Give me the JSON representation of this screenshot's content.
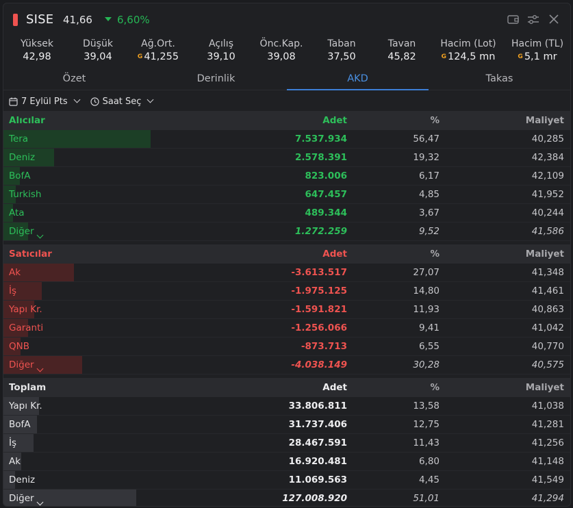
{
  "header": {
    "symbol": "SISE",
    "price": "41,66",
    "change": "6,60%",
    "colors": {
      "accent_red": "#ef5350",
      "up_green": "#26b655",
      "tab_blue": "#4a90e2"
    }
  },
  "stats": [
    {
      "label": "Yüksek",
      "value": "42,98"
    },
    {
      "label": "Düşük",
      "value": "39,04"
    },
    {
      "label": "Ağ.Ort.",
      "value": "41,255",
      "badge": "G"
    },
    {
      "label": "Açılış",
      "value": "39,10"
    },
    {
      "label": "Önc.Kap.",
      "value": "39,08"
    },
    {
      "label": "Taban",
      "value": "37,50"
    },
    {
      "label": "Tavan",
      "value": "45,82"
    },
    {
      "label": "Hacim (Lot)",
      "value": "124,5 mn",
      "badge": "G"
    },
    {
      "label": "Hacim (TL)",
      "value": "5,1 mr",
      "badge": "G"
    }
  ],
  "tabs": [
    {
      "label": "Özet"
    },
    {
      "label": "Derinlik"
    },
    {
      "label": "AKD",
      "active": true
    },
    {
      "label": "Takas"
    }
  ],
  "filters": {
    "date_label": "7 Eylül Pts",
    "time_label": "Saat Seç"
  },
  "buyers": {
    "title": "Alıcılar",
    "col_qty": "Adet",
    "col_pct": "%",
    "col_cost": "Maliyet",
    "rows": [
      {
        "name": "Tera",
        "qty": "7.537.934",
        "pct": "56,47",
        "cost": "40,285",
        "share": 56.47
      },
      {
        "name": "Deniz",
        "qty": "2.578.391",
        "pct": "19,32",
        "cost": "42,384",
        "share": 19.32
      },
      {
        "name": "BofA",
        "qty": "823.006",
        "pct": "6,17",
        "cost": "42,109",
        "share": 6.17
      },
      {
        "name": "Turkish",
        "qty": "647.457",
        "pct": "4,85",
        "cost": "41,952",
        "share": 4.85
      },
      {
        "name": "Ata",
        "qty": "489.344",
        "pct": "3,67",
        "cost": "40,244",
        "share": 3.67
      },
      {
        "name": "Diğer",
        "qty": "1.272.259",
        "pct": "9,52",
        "cost": "41,586",
        "share": 9.52,
        "other": true
      }
    ]
  },
  "sellers": {
    "title": "Satıcılar",
    "col_qty": "Adet",
    "col_pct": "%",
    "col_cost": "Maliyet",
    "rows": [
      {
        "name": "Ak",
        "qty": "-3.613.517",
        "pct": "27,07",
        "cost": "41,348",
        "share": 27.07
      },
      {
        "name": "İş",
        "qty": "-1.975.125",
        "pct": "14,80",
        "cost": "41,461",
        "share": 14.8
      },
      {
        "name": "Yapı Kr.",
        "qty": "-1.591.821",
        "pct": "11,93",
        "cost": "40,863",
        "share": 11.93
      },
      {
        "name": "Garanti",
        "qty": "-1.256.066",
        "pct": "9,41",
        "cost": "41,042",
        "share": 9.41
      },
      {
        "name": "QNB",
        "qty": "-873.713",
        "pct": "6,55",
        "cost": "40,770",
        "share": 6.55
      },
      {
        "name": "Diğer",
        "qty": "-4.038.149",
        "pct": "30,28",
        "cost": "40,575",
        "share": 30.28,
        "other": true
      }
    ]
  },
  "totals": {
    "title": "Toplam",
    "col_qty": "Adet",
    "col_pct": "%",
    "col_cost": "Maliyet",
    "rows": [
      {
        "name": "Yapı Kr.",
        "qty": "33.806.811",
        "pct": "13,58",
        "cost": "41,038",
        "share": 13.58
      },
      {
        "name": "BofA",
        "qty": "31.737.406",
        "pct": "12,75",
        "cost": "41,281",
        "share": 12.75
      },
      {
        "name": "İş",
        "qty": "28.467.591",
        "pct": "11,43",
        "cost": "41,256",
        "share": 11.43
      },
      {
        "name": "Ak",
        "qty": "16.920.481",
        "pct": "6,80",
        "cost": "41,148",
        "share": 6.8
      },
      {
        "name": "Deniz",
        "qty": "11.069.563",
        "pct": "4,45",
        "cost": "41,549",
        "share": 4.45
      },
      {
        "name": "Diğer",
        "qty": "127.008.920",
        "pct": "51,01",
        "cost": "41,294",
        "share": 51.01,
        "other": true
      }
    ]
  }
}
